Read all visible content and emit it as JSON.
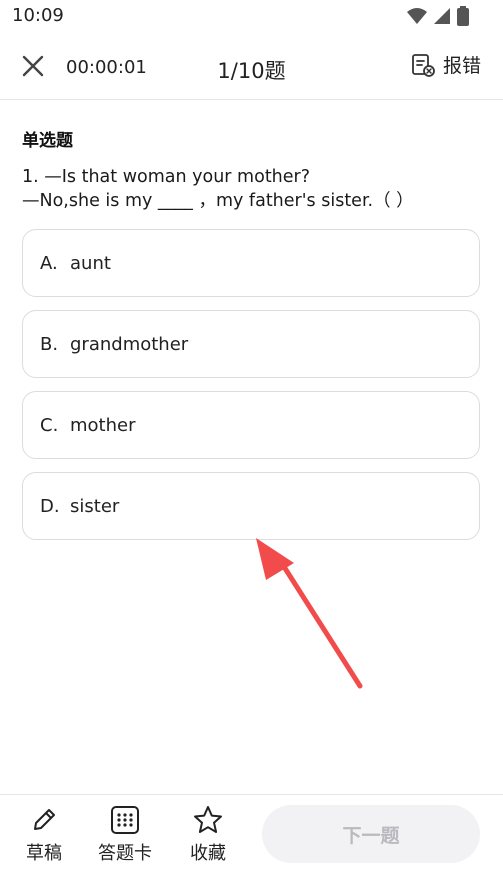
{
  "status_bar": {
    "time": "10:09"
  },
  "header": {
    "timer": "00:00:01",
    "progress": "1/10题",
    "report_label": "报错"
  },
  "question": {
    "type": "单选题",
    "line1": "1.  —Is that woman your mother?",
    "line2": "—No,she is my ____ ，my father's sister.（      ）"
  },
  "options": [
    {
      "letter": "A.",
      "text": "aunt"
    },
    {
      "letter": "B.",
      "text": "grandmother"
    },
    {
      "letter": "C.",
      "text": "mother"
    },
    {
      "letter": "D.",
      "text": "sister"
    }
  ],
  "bottom_bar": {
    "draft_label": "草稿",
    "answer_card_label": "答题卡",
    "favorite_label": "收藏",
    "next_label": "下一题"
  },
  "colors": {
    "annotation_arrow": "#f24b4b",
    "next_button_bg": "#f2f2f4",
    "next_button_text": "#b9b9bf"
  }
}
